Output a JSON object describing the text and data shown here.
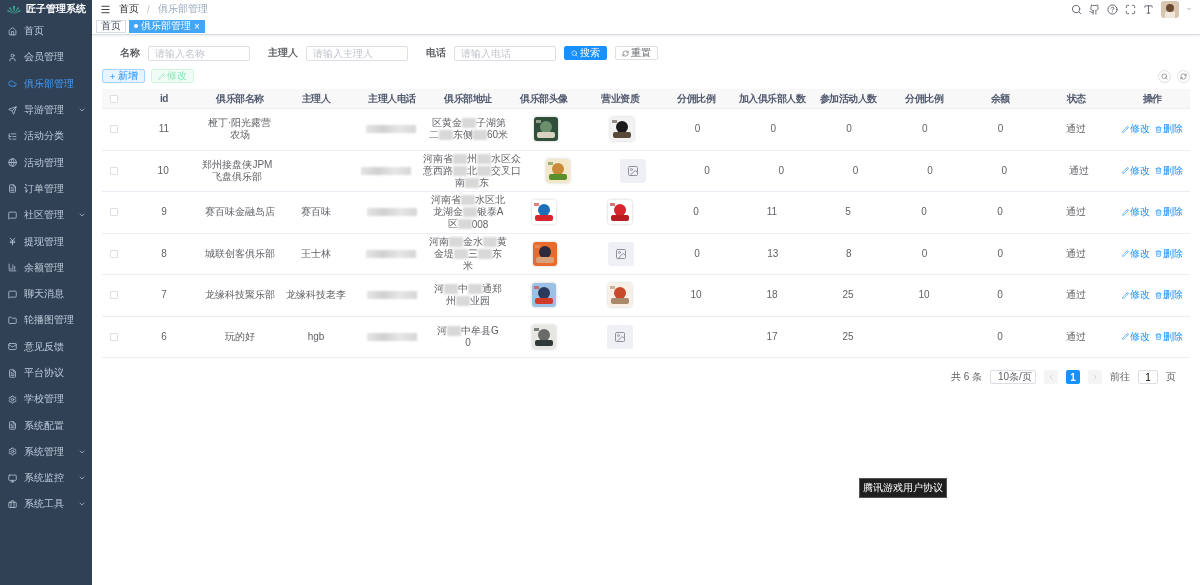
{
  "sidebar": {
    "title": "匠子管理系统",
    "items": [
      {
        "label": "首页",
        "selected": false,
        "expandable": false
      },
      {
        "label": "会员管理",
        "selected": false,
        "expandable": false
      },
      {
        "label": "俱乐部管理",
        "selected": true,
        "expandable": false
      },
      {
        "label": "导游管理",
        "selected": false,
        "expandable": true
      },
      {
        "label": "活动分类",
        "selected": false,
        "expandable": false
      },
      {
        "label": "活动管理",
        "selected": false,
        "expandable": false
      },
      {
        "label": "订单管理",
        "selected": false,
        "expandable": false
      },
      {
        "label": "社区管理",
        "selected": false,
        "expandable": true
      },
      {
        "label": "提现管理",
        "selected": false,
        "expandable": false
      },
      {
        "label": "余额管理",
        "selected": false,
        "expandable": false
      },
      {
        "label": "聊天消息",
        "selected": false,
        "expandable": false
      },
      {
        "label": "轮播图管理",
        "selected": false,
        "expandable": false
      },
      {
        "label": "意见反馈",
        "selected": false,
        "expandable": false
      },
      {
        "label": "平台协议",
        "selected": false,
        "expandable": false
      },
      {
        "label": "学校管理",
        "selected": false,
        "expandable": false
      },
      {
        "label": "系统配置",
        "selected": false,
        "expandable": false
      },
      {
        "label": "系统管理",
        "selected": false,
        "expandable": true
      },
      {
        "label": "系统监控",
        "selected": false,
        "expandable": true
      },
      {
        "label": "系统工具",
        "selected": false,
        "expandable": true
      }
    ]
  },
  "breadcrumb": [
    "首页",
    "俱乐部管理"
  ],
  "breadcrumb_separator": "/",
  "tags": [
    {
      "label": "首页",
      "selected": false
    },
    {
      "label": "俱乐部管理",
      "selected": true,
      "closable": true
    }
  ],
  "tag_close": "×",
  "filters": [
    {
      "label": "名称",
      "placeholder": "请输入名称"
    },
    {
      "label": "主理人",
      "placeholder": "请输入主理人"
    },
    {
      "label": "电话",
      "placeholder": "请输入电话"
    }
  ],
  "search_button": "搜索",
  "reset_button": "重置",
  "toolbar": [
    {
      "label": "新增",
      "kind": "add",
      "disabled": false
    },
    {
      "label": "修改",
      "kind": "edit",
      "disabled": true
    }
  ],
  "table": {
    "select_all_checked": false,
    "columns": [
      "id",
      "俱乐部名称",
      "主理人",
      "主理人电话",
      "俱乐部地址",
      "俱乐部头像",
      "营业资质",
      "分佣比例",
      "加入俱乐部人数",
      "参加活动人数",
      "分佣比例",
      "余额",
      "状态",
      "操作"
    ],
    "rows": [
      {
        "checked": false,
        "id": "11",
        "name": "桠丁·阳光露营农场",
        "address": [
          [
            "区黄金",
            "子湖第"
          ],
          [
            "二",
            "东侧",
            "60米"
          ]
        ],
        "avatar": {
          "kind": "picture"
        },
        "license": {
          "kind": "picture"
        },
        "actions": [
          "修改",
          "删除"
        ],
        "split": "0",
        "joined": "0",
        "activity": "0",
        "split2": "0",
        "balance": "0",
        "status": "通过"
      },
      {
        "checked": false,
        "id": "10",
        "name": "郑州接盘侠JPM飞盘俱乐部",
        "address": [
          [
            "河南省",
            "州",
            "水区众"
          ],
          [
            "意西路",
            "北",
            "交叉口"
          ],
          [
            "南",
            "东"
          ]
        ],
        "avatar": {
          "kind": "picture"
        },
        "license": {
          "kind": "empty"
        },
        "actions": [
          "修改",
          "删除"
        ],
        "split": "0",
        "joined": "0",
        "activity": "0",
        "split2": "0",
        "balance": "0",
        "status": "通过"
      },
      {
        "checked": false,
        "id": "9",
        "name": "赛百味金融岛店",
        "manager": "赛百味",
        "address": [
          [
            "河南省",
            "水区北"
          ],
          [
            "龙湖金",
            "银泰A"
          ],
          [
            "区",
            "008"
          ]
        ],
        "avatar": {
          "kind": "picture"
        },
        "license": {
          "kind": "picture"
        },
        "actions": [
          "修改",
          "删除"
        ],
        "split": "0",
        "joined": "11",
        "activity": "5",
        "split2": "0",
        "balance": "0",
        "status": "通过"
      },
      {
        "checked": false,
        "id": "8",
        "name": "城联创客俱乐部",
        "manager": "王士林",
        "address": [
          [
            "河南",
            "金水",
            "黄"
          ],
          [
            "金堤",
            "三",
            "东"
          ],
          [
            "米"
          ]
        ],
        "avatar": {
          "kind": "picture"
        },
        "license": {
          "kind": "empty"
        },
        "actions": [
          "修改",
          "删除"
        ],
        "split": "0",
        "joined": "13",
        "activity": "8",
        "split2": "0",
        "balance": "0",
        "status": "通过"
      },
      {
        "checked": false,
        "id": "7",
        "name": "龙缘科技聚乐部",
        "manager": "龙缘科技老李",
        "address": [
          [
            "河",
            "中",
            "通郑"
          ],
          [
            "州",
            "业园"
          ]
        ],
        "avatar": {
          "kind": "picture"
        },
        "license": {
          "kind": "picture"
        },
        "actions": [
          "修改",
          "删除"
        ],
        "split": "10",
        "joined": "18",
        "activity": "25",
        "split2": "10",
        "balance": "0",
        "status": "通过"
      },
      {
        "checked": false,
        "id": "6",
        "name": "玩的好",
        "manager": "hgb",
        "address": [
          [
            "河",
            "中牟县G"
          ],
          [
            "0"
          ]
        ],
        "avatar": {
          "kind": "picture"
        },
        "license": {
          "kind": "empty"
        },
        "actions": [
          "修改",
          "删除"
        ],
        "joined": "17",
        "activity": "25",
        "balance": "0",
        "status": "通过"
      }
    ]
  },
  "pagination": {
    "total": "共 6 条",
    "page_size": "10条/页",
    "pages": [
      {
        "label": "1",
        "selected": true
      }
    ],
    "goto_label": "前往",
    "goto_value": "1",
    "goto_suffix": "页"
  },
  "tooltip": "腾讯游戏用户协议"
}
